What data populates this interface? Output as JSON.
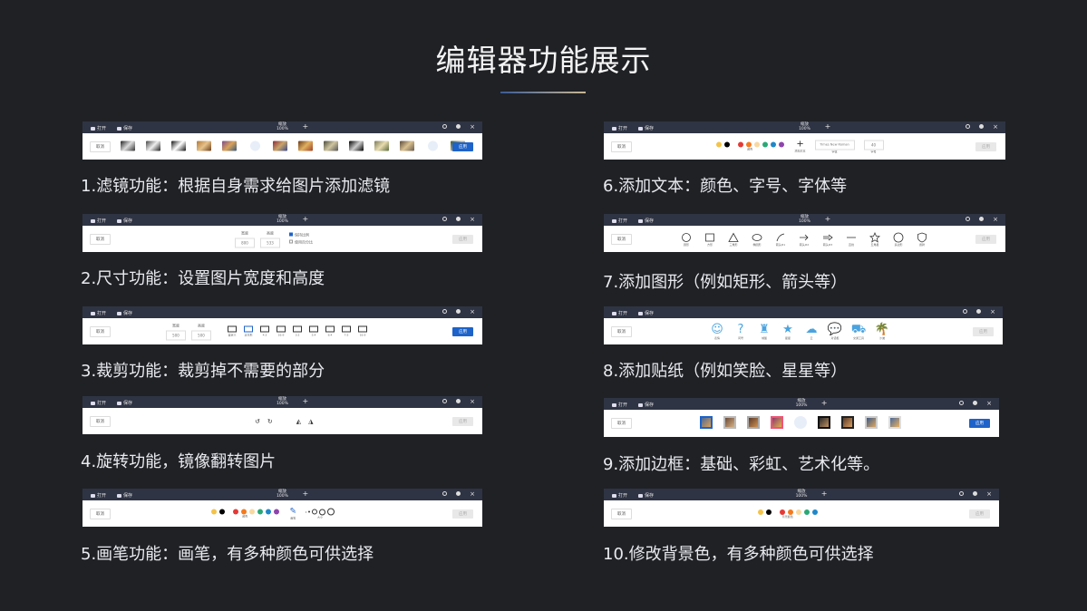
{
  "page": {
    "title": "编辑器功能展示"
  },
  "editor": {
    "open": "打开",
    "save": "保存",
    "zoom_label": "缩放",
    "zoom_value": "100%",
    "cancel": "取消",
    "apply": "应用"
  },
  "features": [
    {
      "label": "1.滤镜功能：根据自身需求给图片添加滤镜"
    },
    {
      "label": "2.尺寸功能：设置图片宽度和高度"
    },
    {
      "label": "3.裁剪功能：裁剪掉不需要的部分"
    },
    {
      "label": "4.旋转功能，镜像翻转图片"
    },
    {
      "label": "5.画笔功能：画笔，有多种颜色可供选择"
    },
    {
      "label": "6.添加文本：颜色、字号、字体等"
    },
    {
      "label": "7.添加图形（例如矩形、箭头等）"
    },
    {
      "label": "8.添加贴纸（例如笑脸、星星等）"
    },
    {
      "label": "9.添加边框：基础、彩虹、艺术化等。"
    },
    {
      "label": "10.修改背景色，有多种颜色可供选择"
    }
  ],
  "size_panel": {
    "width_label": "宽度",
    "height_label": "高度",
    "width": "800",
    "height": "533",
    "lock_ratio": "保持比例",
    "use_percent": "使用百分比"
  },
  "crop_panel": {
    "width_label": "宽度",
    "height_label": "高度",
    "width": "500",
    "height": "500",
    "ratios": [
      "自定义",
      "正方形",
      "4:3",
      "16:9",
      "3:2",
      "5:4",
      "6:4",
      "7:5",
      "16:9"
    ]
  },
  "brush_panel": {
    "color_label": "颜色",
    "brush_label": "画笔",
    "size_label": "大小"
  },
  "text_panel": {
    "color_label": "颜色",
    "add_label": "添加文本",
    "font": "Times New Roman",
    "font_label": "字体",
    "size": "40",
    "size_label": "字号"
  },
  "shapes": [
    "圆形",
    "方形",
    "三角形",
    "椭圆形",
    "箭头#1",
    "箭头#2",
    "箭头#3",
    "直线",
    "五角星",
    "多边形",
    "盾牌"
  ],
  "stickers": [
    "表情",
    "问号",
    "城堡",
    "星星",
    "云",
    "对话框",
    "交通工具",
    "沙滩"
  ],
  "background_panel": {
    "color_label": "背景颜色"
  },
  "colors": {
    "accent": "#1d63c9",
    "topbar": "#2f3444",
    "bg": "#1f2125"
  }
}
